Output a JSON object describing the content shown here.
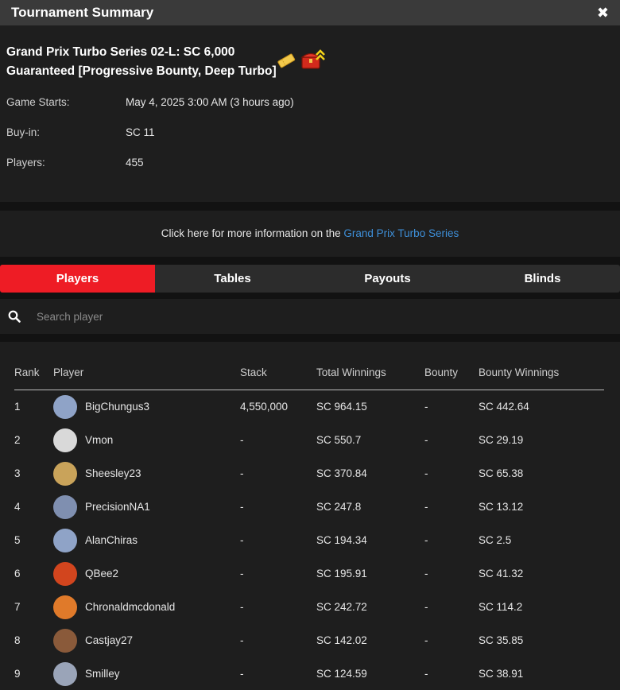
{
  "header": {
    "title": "Tournament Summary",
    "close_icon": "close-icon"
  },
  "tournament": {
    "name": "Grand Prix Turbo Series 02-L: SC 6,000 Guaranteed [Progressive Bounty, Deep Turbo]",
    "icons": [
      "ticket-icon",
      "treasure-chest-icon"
    ],
    "game_starts_label": "Game Starts:",
    "game_starts_value": "May 4, 2025 3:00 AM (3 hours ago)",
    "buyin_label": "Buy-in:",
    "buyin_value": "SC 11",
    "players_label": "Players:",
    "players_value": "455"
  },
  "series": {
    "text": "Click here for more information on the",
    "link": "Grand Prix Turbo Series"
  },
  "tabs": [
    {
      "label": "Players",
      "active": true
    },
    {
      "label": "Tables",
      "active": false
    },
    {
      "label": "Payouts",
      "active": false
    },
    {
      "label": "Blinds",
      "active": false
    }
  ],
  "search": {
    "placeholder": "Search player",
    "icon": "search-icon"
  },
  "table": {
    "columns": [
      "Rank",
      "Player",
      "Stack",
      "Total Winnings",
      "Bounty",
      "Bounty Winnings"
    ],
    "rows": [
      {
        "rank": "1",
        "player": "BigChungus3",
        "stack": "4,550,000",
        "total": "SC 964.15",
        "bounty": "-",
        "bounty_win": "SC 442.64",
        "avatar_color": "#8fa3c7"
      },
      {
        "rank": "2",
        "player": "Vmon",
        "stack": "-",
        "total": "SC 550.7",
        "bounty": "-",
        "bounty_win": "SC 29.19",
        "avatar_color": "#d9d9d9"
      },
      {
        "rank": "3",
        "player": "Sheesley23",
        "stack": "-",
        "total": "SC 370.84",
        "bounty": "-",
        "bounty_win": "SC 65.38",
        "avatar_color": "#c9a35a"
      },
      {
        "rank": "4",
        "player": "PrecisionNA1",
        "stack": "-",
        "total": "SC 247.8",
        "bounty": "-",
        "bounty_win": "SC 13.12",
        "avatar_color": "#7f8fb0"
      },
      {
        "rank": "5",
        "player": "AlanChiras",
        "stack": "-",
        "total": "SC 194.34",
        "bounty": "-",
        "bounty_win": "SC 2.5",
        "avatar_color": "#8fa3c7"
      },
      {
        "rank": "6",
        "player": "QBee2",
        "stack": "-",
        "total": "SC 195.91",
        "bounty": "-",
        "bounty_win": "SC 41.32",
        "avatar_color": "#d2451e"
      },
      {
        "rank": "7",
        "player": "Chronaldmcdonald",
        "stack": "-",
        "total": "SC 242.72",
        "bounty": "-",
        "bounty_win": "SC 114.2",
        "avatar_color": "#e07a2a"
      },
      {
        "rank": "8",
        "player": "Castjay27",
        "stack": "-",
        "total": "SC 142.02",
        "bounty": "-",
        "bounty_win": "SC 35.85",
        "avatar_color": "#8a5a3a"
      },
      {
        "rank": "9",
        "player": "Smilley",
        "stack": "-",
        "total": "SC 124.59",
        "bounty": "-",
        "bounty_win": "SC 38.91",
        "avatar_color": "#9aa4b8"
      }
    ]
  },
  "colors": {
    "accent": "#ee1c25",
    "link": "#3e8fd8",
    "background": "#121212",
    "panel": "#1e1e1e"
  }
}
